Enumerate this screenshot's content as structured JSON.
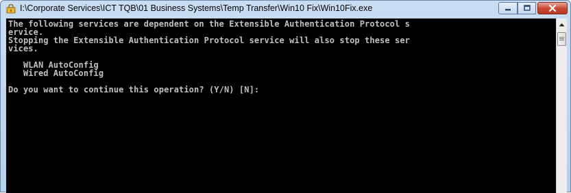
{
  "window": {
    "title": "I:\\Corporate Services\\ICT TQB\\01 Business Systems\\Temp Transfer\\Win10 Fix\\Win10Fix.exe",
    "controls": {
      "minimize": "minimize-icon",
      "maximize": "maximize-icon",
      "close": "close-icon"
    }
  },
  "console": {
    "text": "The following services are dependent on the Extensible Authentication Protocol s\nervice.\nStopping the Extensible Authentication Protocol service will also stop these ser\nvices.\n\n   WLAN AutoConfig\n   Wired AutoConfig\n\nDo you want to continue this operation? (Y/N) [N]:"
  },
  "colors": {
    "console_bg": "#000000",
    "console_fg": "#c0c0c0",
    "close_button": "#c7452e"
  }
}
